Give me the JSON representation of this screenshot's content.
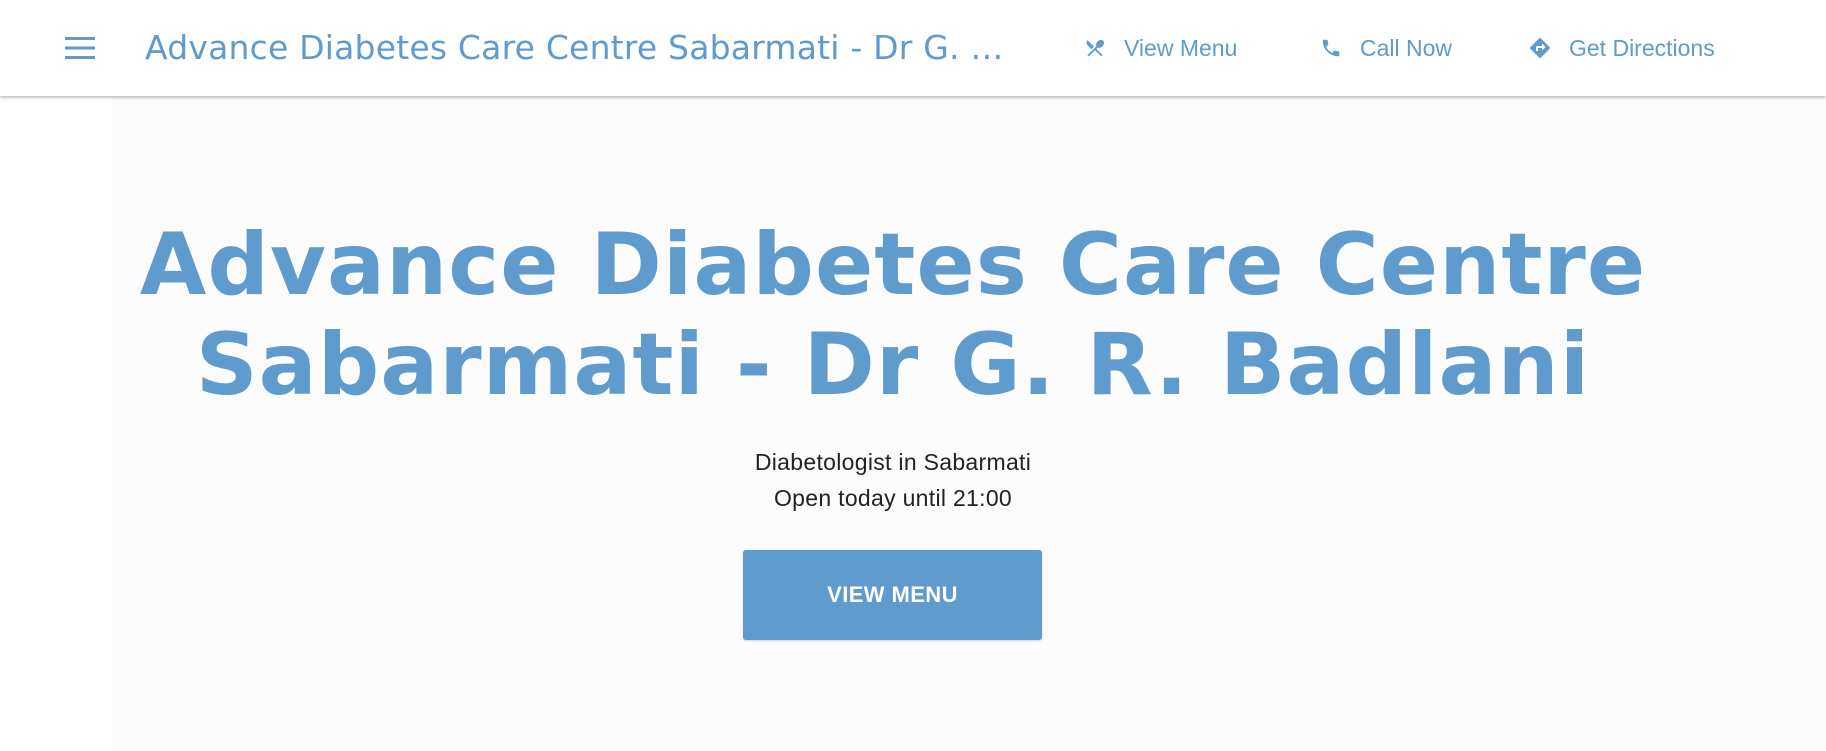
{
  "header": {
    "site_title": "Advance Diabetes Care Centre Sabarmati - Dr G. R. Badlani",
    "nav": {
      "view_menu": "View Menu",
      "call_now": "Call Now",
      "get_directions": "Get Directions"
    }
  },
  "hero": {
    "title_line1": "Advance Diabetes Care Centre",
    "title_line2": "Sabarmati - Dr G. R. Badlani",
    "category": "Diabetologist in Sabarmati",
    "hours": "Open today until 21:00",
    "cta_label": "VIEW MENU"
  },
  "icons": {
    "menu": "hamburger-menu-icon",
    "view_menu": "fork-knife-icon",
    "call_now": "phone-icon",
    "get_directions": "directions-icon"
  },
  "colors": {
    "accent": "#5f9bcd",
    "text": "#222222",
    "background": "#fcfcfd"
  }
}
